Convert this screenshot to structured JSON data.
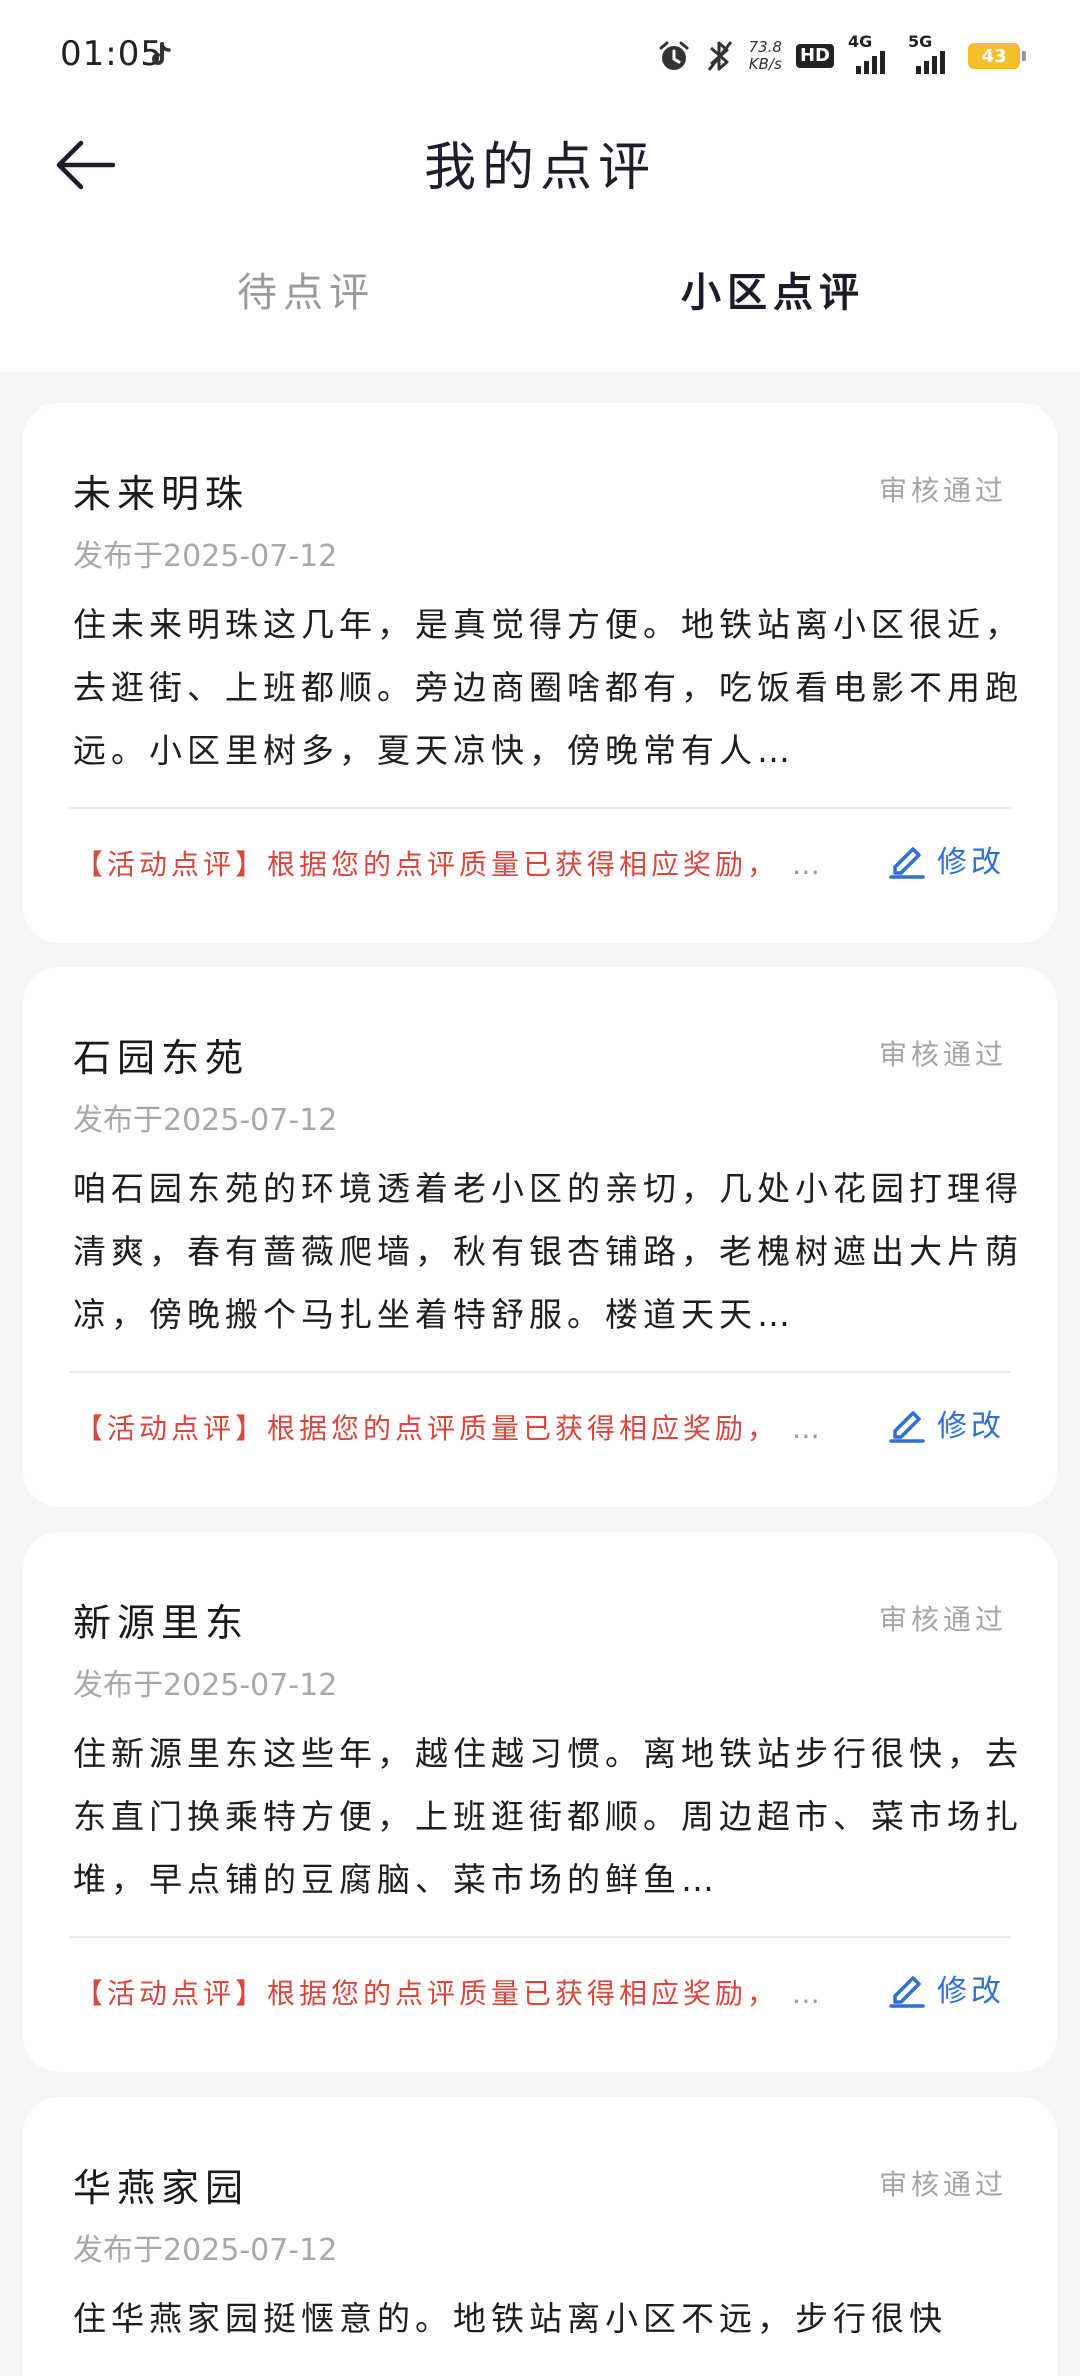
{
  "status_bar": {
    "time": "01:05",
    "net_speed_value": "73.8",
    "net_speed_unit": "KB/s",
    "hd_label": "HD",
    "sim1_label": "4G",
    "sim2_label": "5G",
    "battery": "43",
    "icons": [
      "tiktok-icon",
      "alarm-icon",
      "bluetooth-icon",
      "signal-icon",
      "battery-icon"
    ]
  },
  "header": {
    "title": "我的点评",
    "back_icon": "arrow-left-icon"
  },
  "tabs": [
    {
      "label": "待点评",
      "active": false
    },
    {
      "label": "小区点评",
      "active": true
    }
  ],
  "colors": {
    "accent": "#2f6fd6",
    "reward": "#d9473e",
    "status": "#a5a5a5"
  },
  "reviews": [
    {
      "name": "未来明珠",
      "status": "审核通过",
      "date": "发布于2025-07-12",
      "body": "住未来明珠这几年，是真觉得方便。地铁站离小区很近，去逛街、上班都顺。旁边商圈啥都有，吃饭看电影不用跑远。小区里树多，夏天凉快，傍晚常有人…",
      "reward": "【活动点评】根据您的点评质量已获得相应奖励，",
      "reward_ellipsis": "…",
      "edit_label": "修改"
    },
    {
      "name": "石园东苑",
      "status": "审核通过",
      "date": "发布于2025-07-12",
      "body": "咱石园东苑的环境透着老小区的亲切，几处小花园打理得清爽，春有蔷薇爬墙，秋有银杏铺路，老槐树遮出大片荫凉，傍晚搬个马扎坐着特舒服。楼道天天…",
      "reward": "【活动点评】根据您的点评质量已获得相应奖励，",
      "reward_ellipsis": "…",
      "edit_label": "修改"
    },
    {
      "name": "新源里东",
      "status": "审核通过",
      "date": "发布于2025-07-12",
      "body": "住新源里东这些年，越住越习惯。离地铁站步行很快，去东直门换乘特方便，上班逛街都顺。周边超市、菜市场扎堆，早点铺的豆腐脑、菜市场的鲜鱼…",
      "reward": "【活动点评】根据您的点评质量已获得相应奖励，",
      "reward_ellipsis": "…",
      "edit_label": "修改"
    },
    {
      "name": "华燕家园",
      "status": "审核通过",
      "date": "发布于2025-07-12",
      "body": "住华燕家园挺惬意的。地铁站离小区不远，步行很快",
      "reward": "",
      "reward_ellipsis": "",
      "edit_label": ""
    }
  ]
}
